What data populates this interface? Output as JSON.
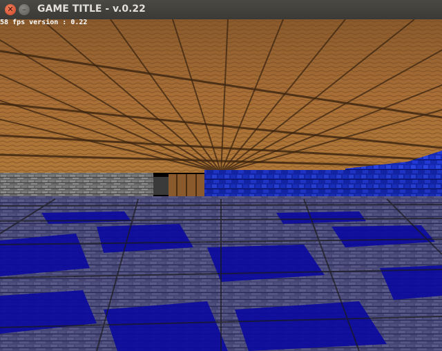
{
  "window": {
    "title": "GAME TITLE - v.0.22"
  },
  "hud": {
    "fps_text": "58 fps version : 0.22"
  },
  "colors": {
    "titlebar": "#3f3e3a",
    "close": "#e0562f",
    "ceiling_wood": "#a06a34",
    "wall_stone": "#5a5a5a",
    "wall_blue": "#1a2dc4",
    "floor_blue": "#0a0a8a",
    "floor_stone": "#8a8a8a"
  },
  "icons": {
    "close": "close-icon",
    "minimize": "minimize-icon"
  }
}
